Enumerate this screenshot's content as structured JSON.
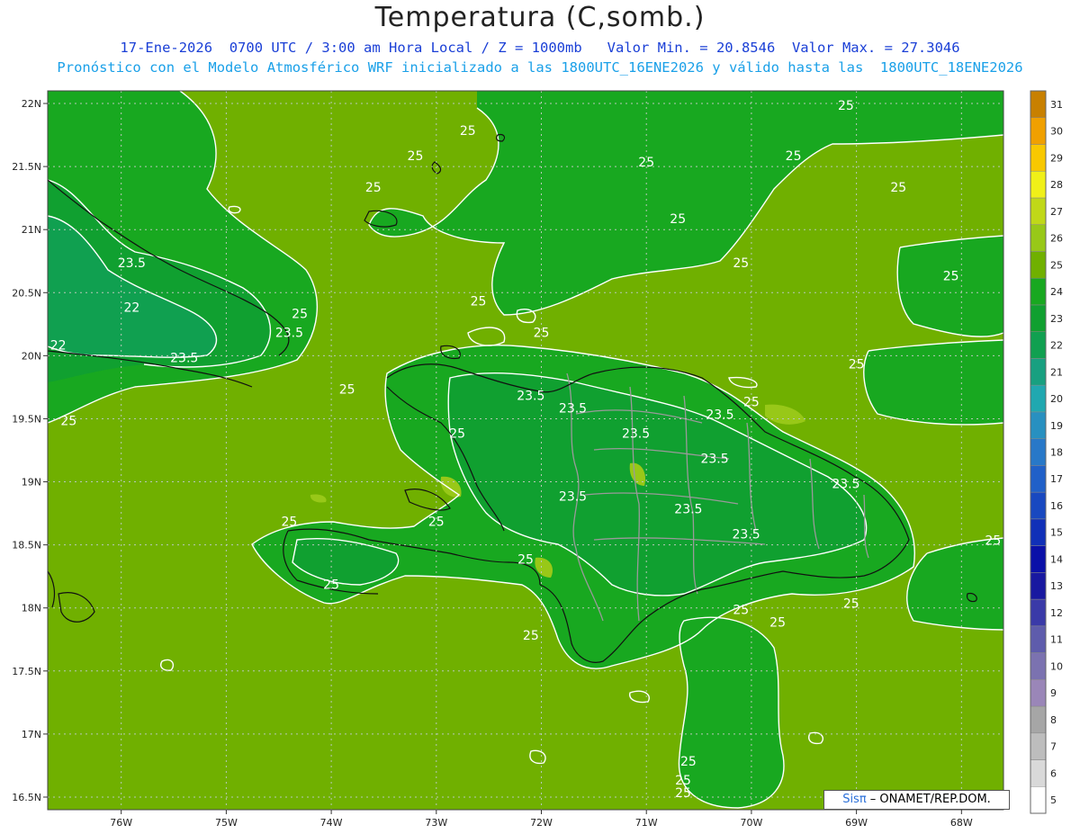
{
  "header": {
    "title": "Temperatura (C,somb.)",
    "subtitle_line1": "17-Ene-2026  0700 UTC / 3:00 am Hora Local / Z = 1000mb   Valor Min. = 20.8546  Valor Max. = 27.3046",
    "subtitle_line2": "Pronóstico con el Modelo Atmosférico WRF inicializado a las 1800UTC_16ENE2026 y válido hasta las  1800UTC_18ENE2026"
  },
  "credit": {
    "brand": "Sisπ",
    "text": " – ONAMET/REP.DOM."
  },
  "axes": {
    "lat_labels": [
      "22N",
      "21.5N",
      "21N",
      "20.5N",
      "20N",
      "19.5N",
      "19N",
      "18.5N",
      "18N",
      "17.5N",
      "17N",
      "16.5N"
    ],
    "lat_values": [
      22,
      21.5,
      21,
      20.5,
      20,
      19.5,
      19,
      18.5,
      18,
      17.5,
      17,
      16.5
    ],
    "lon_labels": [
      "76W",
      "75W",
      "74W",
      "73W",
      "72W",
      "71W",
      "70W",
      "69W",
      "68W"
    ],
    "lon_values": [
      -76,
      -75,
      -74,
      -73,
      -72,
      -71,
      -70,
      -69,
      -68
    ],
    "lat_range": [
      16.4,
      22.1
    ],
    "lon_range": [
      -76.7,
      -67.6
    ]
  },
  "colorbar": {
    "levels": [
      "5",
      "6",
      "7",
      "8",
      "9",
      "10",
      "11",
      "12",
      "13",
      "14",
      "15",
      "16",
      "17",
      "18",
      "19",
      "20",
      "21",
      "22",
      "23",
      "24",
      "25",
      "26",
      "27",
      "28",
      "29",
      "30",
      "31"
    ],
    "colors": [
      "#ffffff",
      "#d9d9d9",
      "#bdbdbd",
      "#a6a6a6",
      "#9a86b8",
      "#7b72b0",
      "#5e5cac",
      "#3a3aa8",
      "#1818a0",
      "#0a10a8",
      "#1030b8",
      "#1848c0",
      "#2060c8",
      "#2878c8",
      "#2890c0",
      "#20a8b0",
      "#18a080",
      "#10a050",
      "#10a030",
      "#18a820",
      "#70b000",
      "#98c818",
      "#c0d818",
      "#f0f018",
      "#f8c800",
      "#f0a000",
      "#c88000"
    ]
  },
  "contour_labels": [
    {
      "text": "25",
      "lat": 21.95,
      "lon": -69.1
    },
    {
      "text": "25",
      "lat": 21.75,
      "lon": -72.7
    },
    {
      "text": "25",
      "lat": 21.55,
      "lon": -73.2
    },
    {
      "text": "25",
      "lat": 21.5,
      "lon": -71.0
    },
    {
      "text": "25",
      "lat": 21.55,
      "lon": -69.6
    },
    {
      "text": "25",
      "lat": 21.3,
      "lon": -73.6
    },
    {
      "text": "25",
      "lat": 21.3,
      "lon": -68.6
    },
    {
      "text": "25",
      "lat": 21.05,
      "lon": -70.7
    },
    {
      "text": "25",
      "lat": 20.7,
      "lon": -70.1
    },
    {
      "text": "25",
      "lat": 20.6,
      "lon": -68.1
    },
    {
      "text": "23.5",
      "lat": 20.7,
      "lon": -75.9
    },
    {
      "text": "22",
      "lat": 20.35,
      "lon": -75.9
    },
    {
      "text": "22",
      "lat": 20.05,
      "lon": -76.6
    },
    {
      "text": "25",
      "lat": 20.3,
      "lon": -74.3
    },
    {
      "text": "23.5",
      "lat": 20.15,
      "lon": -74.4
    },
    {
      "text": "25",
      "lat": 20.4,
      "lon": -72.6
    },
    {
      "text": "25",
      "lat": 20.15,
      "lon": -72.0
    },
    {
      "text": "23.5",
      "lat": 19.95,
      "lon": -75.4
    },
    {
      "text": "25",
      "lat": 19.9,
      "lon": -69.0
    },
    {
      "text": "25",
      "lat": 19.7,
      "lon": -73.85
    },
    {
      "text": "23.5",
      "lat": 19.65,
      "lon": -72.1
    },
    {
      "text": "23.5",
      "lat": 19.55,
      "lon": -71.7
    },
    {
      "text": "25",
      "lat": 19.6,
      "lon": -70.0
    },
    {
      "text": "23.5",
      "lat": 19.5,
      "lon": -70.3
    },
    {
      "text": "25",
      "lat": 19.45,
      "lon": -76.5
    },
    {
      "text": "23.5",
      "lat": 19.35,
      "lon": -71.1
    },
    {
      "text": "25",
      "lat": 19.35,
      "lon": -72.8
    },
    {
      "text": "23.5",
      "lat": 19.15,
      "lon": -70.35
    },
    {
      "text": "23.5",
      "lat": 18.95,
      "lon": -69.1
    },
    {
      "text": "23.5",
      "lat": 18.85,
      "lon": -71.7
    },
    {
      "text": "23.5",
      "lat": 18.75,
      "lon": -70.6
    },
    {
      "text": "25",
      "lat": 18.65,
      "lon": -74.4
    },
    {
      "text": "25",
      "lat": 18.65,
      "lon": -73.0
    },
    {
      "text": "23.5",
      "lat": 18.55,
      "lon": -70.05
    },
    {
      "text": "25",
      "lat": 18.5,
      "lon": -67.7
    },
    {
      "text": "25",
      "lat": 18.35,
      "lon": -72.15
    },
    {
      "text": "25",
      "lat": 18.15,
      "lon": -74.0
    },
    {
      "text": "25",
      "lat": 18.0,
      "lon": -69.05
    },
    {
      "text": "25",
      "lat": 17.95,
      "lon": -70.1
    },
    {
      "text": "25",
      "lat": 17.85,
      "lon": -69.75
    },
    {
      "text": "25",
      "lat": 17.75,
      "lon": -72.1
    },
    {
      "text": "25",
      "lat": 16.75,
      "lon": -70.6
    },
    {
      "text": "25",
      "lat": 16.6,
      "lon": -70.65
    },
    {
      "text": "25",
      "lat": 16.5,
      "lon": -70.65
    }
  ]
}
